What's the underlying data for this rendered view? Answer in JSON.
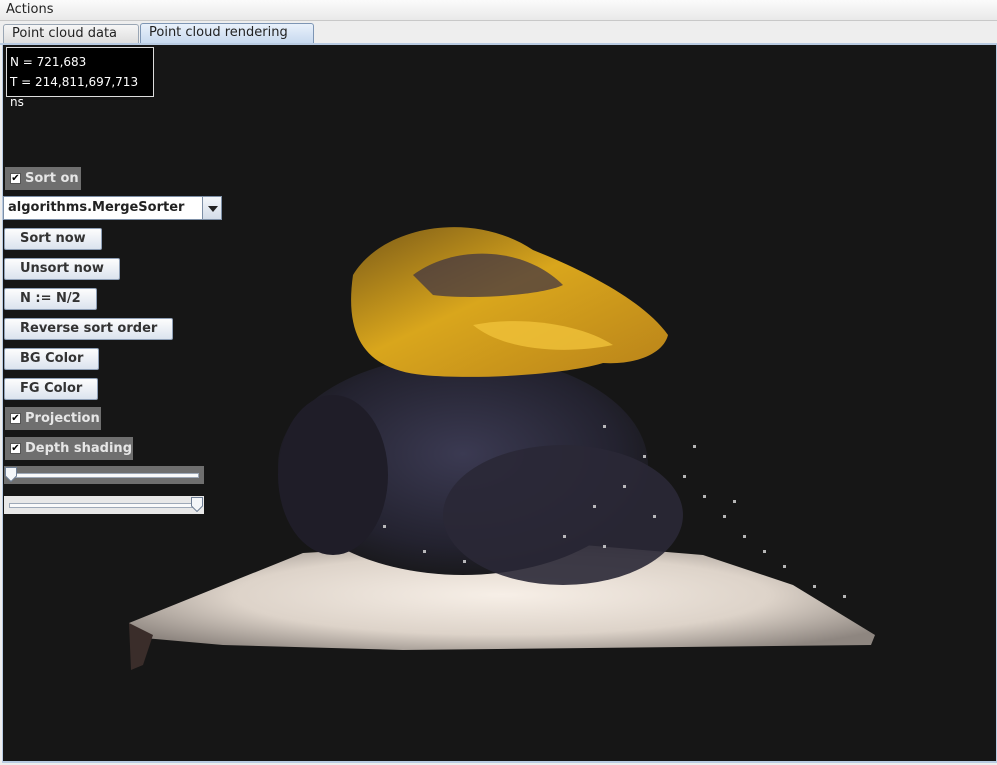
{
  "menubar": {
    "actions_label": "Actions"
  },
  "tabs": [
    {
      "label": "Point cloud data",
      "selected": false
    },
    {
      "label": "Point cloud rendering",
      "selected": true
    }
  ],
  "stats": {
    "n_text": "N = 721,683",
    "t_text": "T = 214,811,697,713 ns"
  },
  "controls": {
    "sort_on": {
      "label": "Sort on",
      "checked": true
    },
    "sorter_select": {
      "value": "algorithms.MergeSorter"
    },
    "sort_now_label": "Sort now",
    "unsort_now_label": "Unsort now",
    "halve_n_label": "N := N/2",
    "reverse_sort_label": "Reverse sort order",
    "bg_color_label": "BG Color",
    "fg_color_label": "FG Color",
    "projection": {
      "label": "Projection",
      "checked": true
    },
    "depth_shading": {
      "label": "Depth shading",
      "checked": true
    },
    "slider1_value": 0.0,
    "slider2_value": 1.0
  },
  "colors": {
    "canvas_bg": "#161616",
    "accent_tab": "#c6d8ee",
    "cloud_yellow": "#d9a61c",
    "cloud_white": "#efe9e2"
  }
}
